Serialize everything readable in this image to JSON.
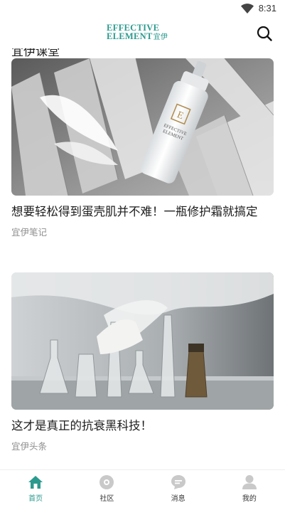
{
  "status_bar": {
    "time": "8:31"
  },
  "header": {
    "logo_line1": "EFFECTIVE",
    "logo_line2": "ELEMENT",
    "logo_cn": "宜伊",
    "brand_color": "#2b9a8e"
  },
  "feed": {
    "partial_heading": "宜伊课堂",
    "cards": [
      {
        "title": "想要轻松得到蛋壳肌并不难！一瓶修护霜就搞定",
        "source": "宜伊笔记",
        "image": "skincare-bottle-photo",
        "bottle_brand_line1": "EFFECTIVE",
        "bottle_brand_line2": "ELEMENT"
      },
      {
        "title": "这才是真正的抗衰黑科技！",
        "source": "宜伊头条",
        "image": "laboratory-glassware-photo"
      }
    ]
  },
  "tab_bar": {
    "active_color": "#2b9a8e",
    "items": [
      {
        "label": "首页",
        "icon": "home-icon",
        "active": true
      },
      {
        "label": "社区",
        "icon": "community-icon",
        "active": false
      },
      {
        "label": "消息",
        "icon": "message-icon",
        "active": false
      },
      {
        "label": "我的",
        "icon": "profile-icon",
        "active": false
      }
    ]
  }
}
